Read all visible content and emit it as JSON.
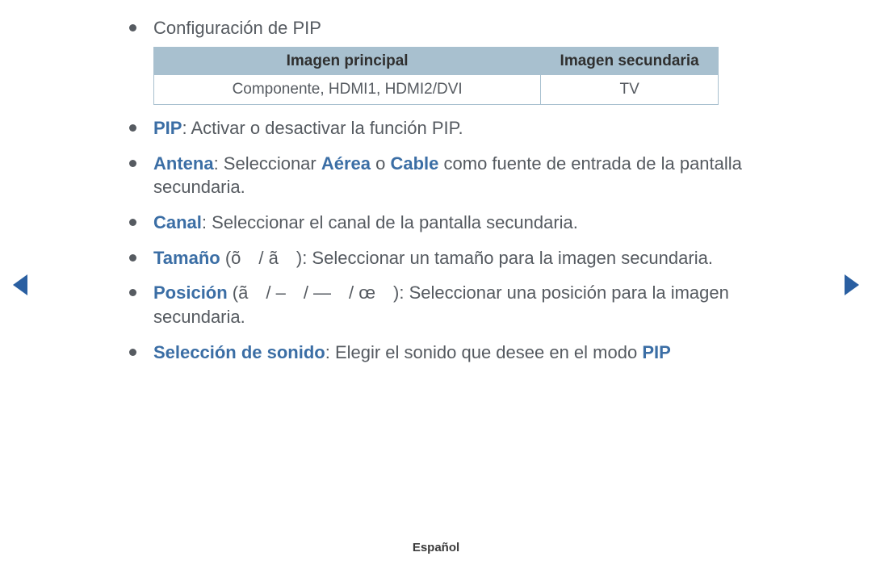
{
  "nav": {
    "prev": "prev",
    "next": "next"
  },
  "title": "Configuración de PIP",
  "table": {
    "headers": [
      "Imagen principal",
      "Imagen secundaria"
    ],
    "row": [
      "Componente, HDMI1, HDMI2/DVI",
      "TV"
    ]
  },
  "items": {
    "pip": {
      "label": "PIP",
      "desc": ": Activar o desactivar la función PIP."
    },
    "antena": {
      "label": "Antena",
      "pre": ": Seleccionar ",
      "opt1": "Aérea",
      "mid": " o ",
      "opt2": "Cable",
      "post": " como fuente de entrada de la pantalla secundaria."
    },
    "canal": {
      "label": "Canal",
      "desc": ": Seleccionar el canal de la pantalla secundaria."
    },
    "tamano": {
      "label": "Tamaño",
      "symbols": " (õ / ã )",
      "desc": ": Seleccionar un tamaño para la imagen secundaria."
    },
    "posicion": {
      "label": "Posición",
      "symbols": " (ã / – / — / œ )",
      "desc": ": Seleccionar una posición para la imagen secundaria."
    },
    "sonido": {
      "label": "Selección de sonido",
      "desc": ": Elegir el sonido que desee en el modo ",
      "mode": "PIP"
    }
  },
  "footer": "Español"
}
